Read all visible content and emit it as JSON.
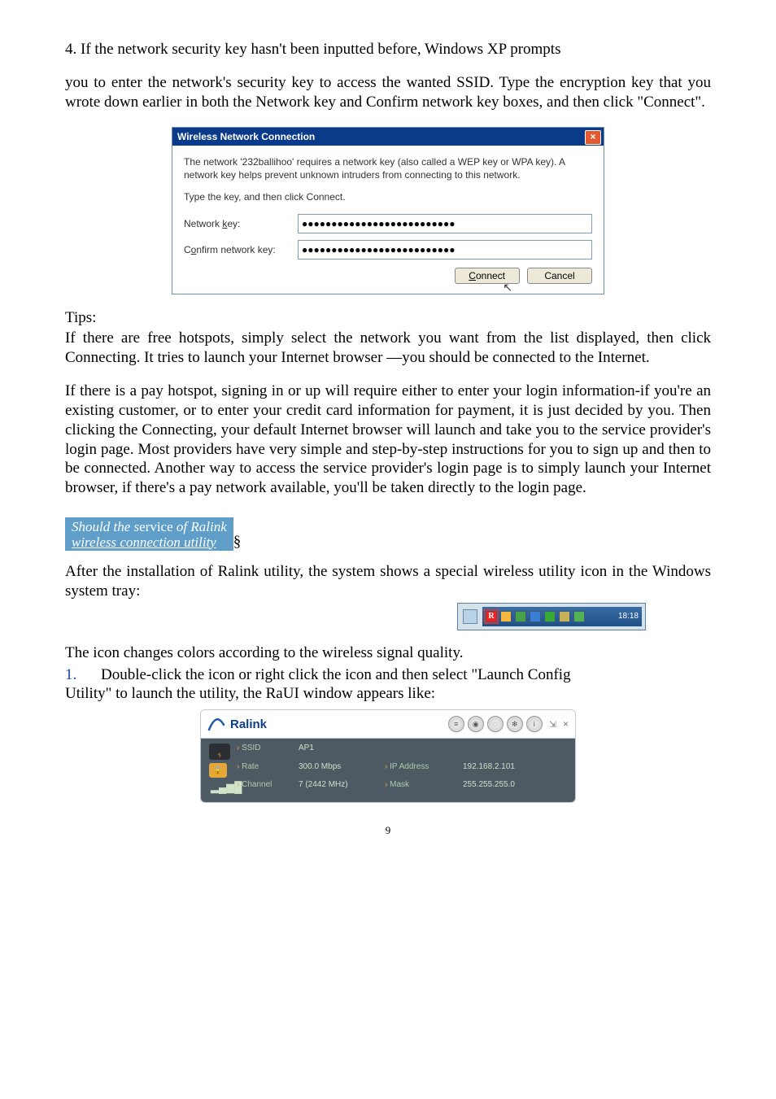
{
  "step4_heading": "4. If the network security key hasn't been inputted before, Windows XP prompts",
  "step4_body": "you to enter the network's security key to access the wanted SSID. Type the encryption key that you wrote down earlier in both the Network key and Confirm network key boxes, and then click \"Connect\".",
  "dialog": {
    "title": "Wireless Network Connection",
    "description": "The network '232ballihoo' requires a network key (also called a WEP key or WPA key). A network key helps prevent unknown intruders from connecting to this network.",
    "instruction": "Type the key, and then click Connect.",
    "network_key_label_pre": "Network ",
    "network_key_label_ul": "k",
    "network_key_label_post": "ey:",
    "confirm_label_pre": "C",
    "confirm_label_ul": "o",
    "confirm_label_post": "nfirm network key:",
    "network_key_value": "●●●●●●●●●●●●●●●●●●●●●●●●●●",
    "confirm_value": "●●●●●●●●●●●●●●●●●●●●●●●●●●",
    "connect_ul": "C",
    "connect_rest": "onnect",
    "cancel": "Cancel"
  },
  "tips_label": "Tips:",
  "tip1": " If there are free hotspots, simply select the network you want from the list displayed, then click Connecting. It tries to launch your Internet browser —you should be connected to the Internet.",
  "tip2": " If there is a pay hotspot, signing in or up will require either to enter your login information-if you're an existing customer, or to enter your credit card information for payment, it is just decided by you. Then clicking the Connecting, your default Internet browser will launch and take you to the service provider's login page. Most providers have very simple and step-by-step instructions for you to sign up and then to be connected. Another way to access the service provider's login page is to simply launch your Internet browser, if there's a pay network available, you'll be taken directly to the login page.",
  "section": {
    "line1_a": "Should the s",
    "line1_b": "ervice",
    "line1_c": " of Ralink",
    "line2": "wireless connection utility"
  },
  "section_suffix": "§",
  "after_section": "  After the installation of Ralink utility, the system shows a special wireless utility icon in the Windows system tray:",
  "tray_time": "18:18",
  "icon_line": " The icon changes colors according to the wireless signal quality.",
  "enum_num": "1.",
  "enum_text_a": "Double-click the icon or right click the icon and then select \"Launch Config",
  "enum_text_b": "Utility\" to launch the utility, the RaUI window appears like:",
  "ralink": {
    "logo": "Ralink",
    "ssid_label": "SSID",
    "ssid_value": "AP1",
    "rate_label": "Rate",
    "rate_value": "300.0 Mbps",
    "ip_label": "IP Address",
    "ip_value": "192.168.2.101",
    "channel_label": "Channel",
    "channel_value": "7 (2442 MHz)",
    "mask_label": "Mask",
    "mask_value": "255.255.255.0"
  },
  "page_number": "9"
}
